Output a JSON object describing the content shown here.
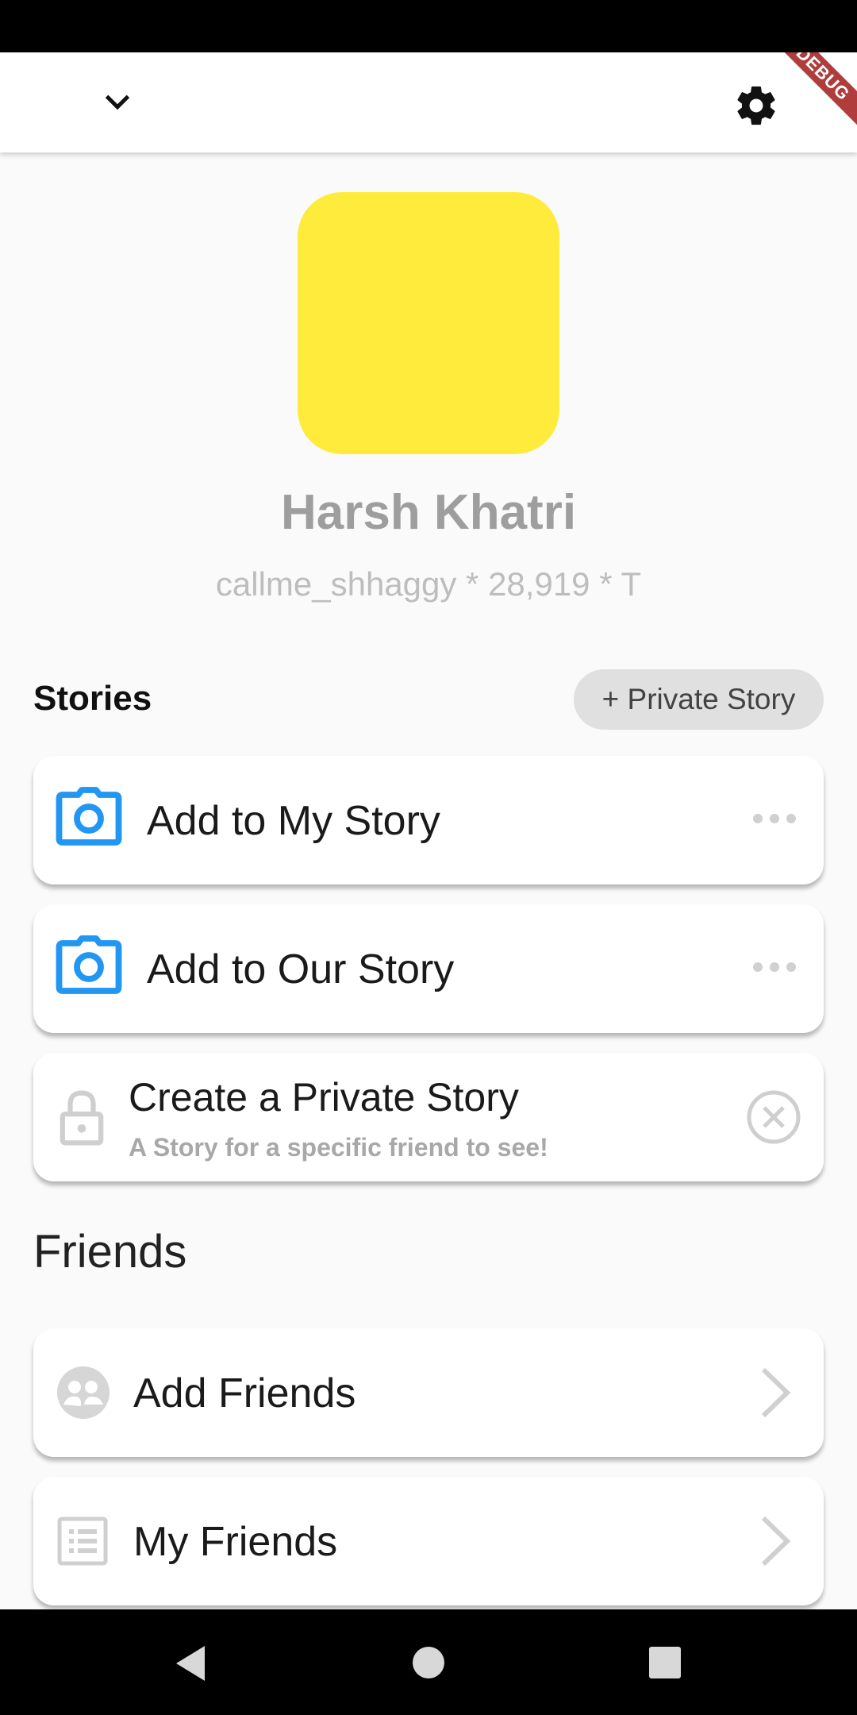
{
  "app_bar": {
    "debug_label": "DEBUG"
  },
  "profile": {
    "name": "Harsh Khatri",
    "subtitle": "callme_shhaggy * 28,919 * T",
    "avatar_color": "#ffeb3b"
  },
  "stories": {
    "heading": "Stories",
    "private_story_button": "+ Private Story",
    "items": [
      {
        "title": "Add to My Story",
        "icon": "camera-icon",
        "action_icon": "more-horizontal-icon"
      },
      {
        "title": "Add to Our Story",
        "icon": "camera-icon",
        "action_icon": "more-horizontal-icon"
      },
      {
        "title": "Create a Private Story",
        "description": "A Story for a specific friend to see!",
        "icon": "lock-icon",
        "action_icon": "close-circle-icon"
      }
    ]
  },
  "friends": {
    "heading": "Friends",
    "items": [
      {
        "title": "Add Friends",
        "icon": "add-friends-icon",
        "action_icon": "chevron-right-icon"
      },
      {
        "title": "My Friends",
        "icon": "friends-list-icon",
        "action_icon": "chevron-right-icon"
      }
    ]
  },
  "colors": {
    "accent_blue": "#2196f3",
    "avatar_yellow": "#ffeb3b",
    "muted_gray": "#9e9e9e"
  }
}
